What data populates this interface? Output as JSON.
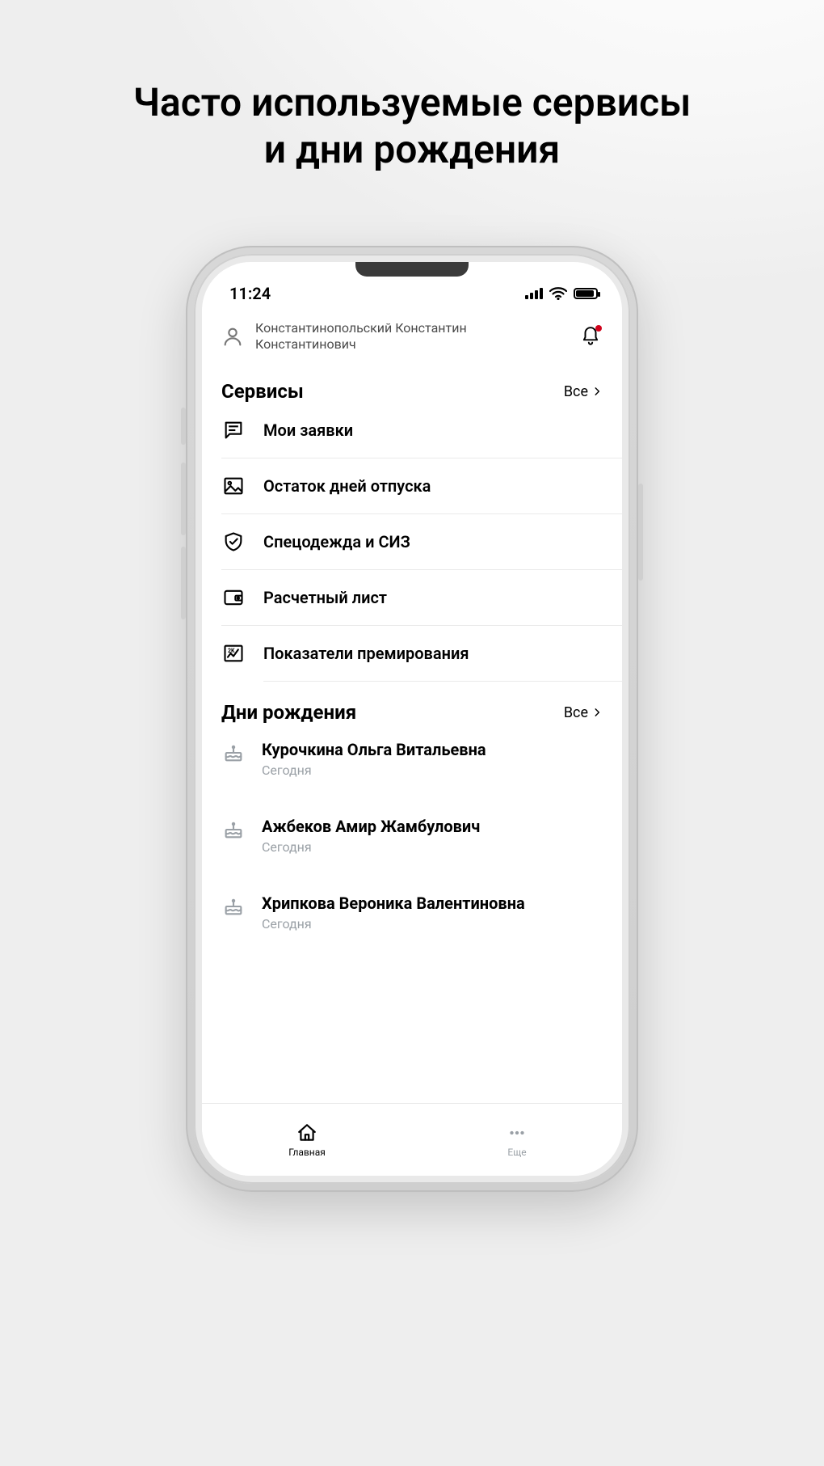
{
  "page": {
    "title_line1": "Часто используемые сервисы",
    "title_line2": "и дни рождения"
  },
  "status_bar": {
    "time": "11:24"
  },
  "header": {
    "user_name": "Константинопольский Константин Константинович"
  },
  "sections": {
    "services": {
      "title": "Сервисы",
      "see_all": "Все"
    },
    "birthdays": {
      "title": "Дни рождения",
      "see_all": "Все"
    }
  },
  "services": [
    {
      "label": "Мои заявки"
    },
    {
      "label": "Остаток дней отпуска"
    },
    {
      "label": "Спецодежда и СИЗ"
    },
    {
      "label": "Расчетный лист"
    },
    {
      "label": "Показатели премирования"
    }
  ],
  "birthdays": [
    {
      "name": "Курочкина Ольга Витальевна",
      "when": "Сегодня"
    },
    {
      "name": "Ажбеков Амир Жамбулович",
      "when": "Сегодня"
    },
    {
      "name": "Хрипкова Вероника Валентиновна",
      "when": "Сегодня"
    }
  ],
  "tabs": {
    "home": "Главная",
    "more": "Еще"
  }
}
